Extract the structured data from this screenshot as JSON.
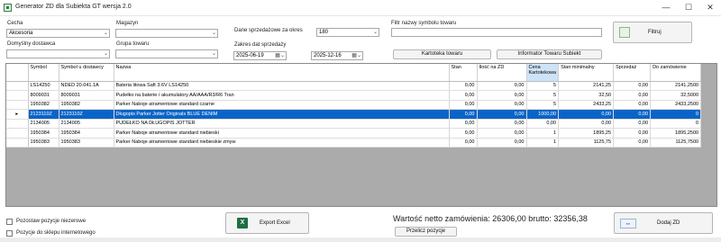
{
  "window": {
    "title": "Generator ZD dla Subiekta GT wersja 2.0",
    "minimize": "—",
    "maximize": "☐",
    "close": "✕"
  },
  "filters": {
    "cecha_label": "Cecha",
    "cecha_value": "Akcesoria",
    "magazyn_label": "Magazyn",
    "magazyn_value": "",
    "domyslny_dostawca_label": "Domyślny dostawca",
    "domyslny_dostawca_value": "",
    "grupa_towaru_label": "Grupa towaru",
    "grupa_towaru_value": "",
    "dane_sprzedazowe_label": "Dane sprzedażowe za okres",
    "dane_sprzedazowe_value": "180",
    "zakres_dat_label": "Zakres dat sprzedaży",
    "date_from": "2025-06-19",
    "date_to": "2025-12-16",
    "filtr_symbolu_label": "Filtr nazwy symbolu towaru",
    "filtr_symbolu_value": ""
  },
  "buttons": {
    "kartoteka": "Kartoteka towaru",
    "informator": "Informator Towaru Subiekt",
    "filtruj": "Filtruj",
    "export_excel": "Export Excel",
    "przelicz": "Przelicz pozycje",
    "dodaj_zd": "Dodaj ZD"
  },
  "grid": {
    "columns": [
      "Symbol",
      "Symbol u dostawcy",
      "Nazwa",
      "Stan",
      "Ilość na ZD",
      "Cena Kartotekowa",
      "Stan minimalny",
      "Sprzedaż",
      "Do zamówienie"
    ],
    "rows": [
      {
        "symbol": "LS14250",
        "symbol_dost": "NDED 20.041.1A",
        "nazwa": "Bateria litowa Saft 3.6V LS14250",
        "stan": "0,00",
        "ilosc": "0,00",
        "cena": "5",
        "stan_min": "2141,25",
        "sprzedaz": "0,00",
        "do_zam": "2141,2500",
        "selected": false
      },
      {
        "symbol": "8009031",
        "symbol_dost": "8009031",
        "nazwa": "Pudełko na baterie / akumulatory AA/AAA/R3/R6 Tran",
        "stan": "0,00",
        "ilosc": "0,00",
        "cena": "5",
        "stan_min": "32,50",
        "sprzedaz": "0,00",
        "do_zam": "32,5000",
        "selected": false
      },
      {
        "symbol": "1950382",
        "symbol_dost": "1950382",
        "nazwa": "Parker Naboje atramentowe standard czarne",
        "stan": "0,00",
        "ilosc": "0,00",
        "cena": "5",
        "stan_min": "2433,25",
        "sprzedaz": "0,00",
        "do_zam": "2433,2500",
        "selected": false
      },
      {
        "symbol": "2123110Z",
        "symbol_dost": "2123110Z",
        "nazwa": "Długopis Parker Jotter Originals BLUE DENIM",
        "stan": "0,00",
        "ilosc": "0,00",
        "cena": "1000,00",
        "stan_min": "0,00",
        "sprzedaz": "0,00",
        "do_zam": "0",
        "selected": true
      },
      {
        "symbol": "2134005",
        "symbol_dost": "2134005",
        "nazwa": "PUDEŁKO NA DŁUGOPIS JOTTER",
        "stan": "0,00",
        "ilosc": "0,00",
        "cena": "0,00",
        "stan_min": "0,00",
        "sprzedaz": "0,00",
        "do_zam": "0",
        "selected": false
      },
      {
        "symbol": "1950384",
        "symbol_dost": "1950384",
        "nazwa": "Parker Naboje atramentowe standard niebieski",
        "stan": "0,00",
        "ilosc": "0,00",
        "cena": "1",
        "stan_min": "1895,25",
        "sprzedaz": "0,00",
        "do_zam": "1895,2500",
        "selected": false
      },
      {
        "symbol": "1950383",
        "symbol_dost": "1950383",
        "nazwa": "Parker Naboje atramentowe standard niebieskie zmyw",
        "stan": "0,00",
        "ilosc": "0,00",
        "cena": "1",
        "stan_min": "1125,75",
        "sprzedaz": "0,00",
        "do_zam": "1125,7500",
        "selected": false
      }
    ]
  },
  "options": {
    "pozostaw_label": "Pozostaw pozycje niezerowe",
    "pozycje_sklep_label": "Pozycje do sklepu internetowego"
  },
  "summary": {
    "wartosc_label": "Wartość netto zamówienia:",
    "netto": "26306,00",
    "brutto_label": "brutto:",
    "brutto": "32356,38"
  },
  "colors": {
    "selection": "#0a64c8",
    "sorted_header": "#cfe3f7",
    "grid_background": "#ababab"
  }
}
